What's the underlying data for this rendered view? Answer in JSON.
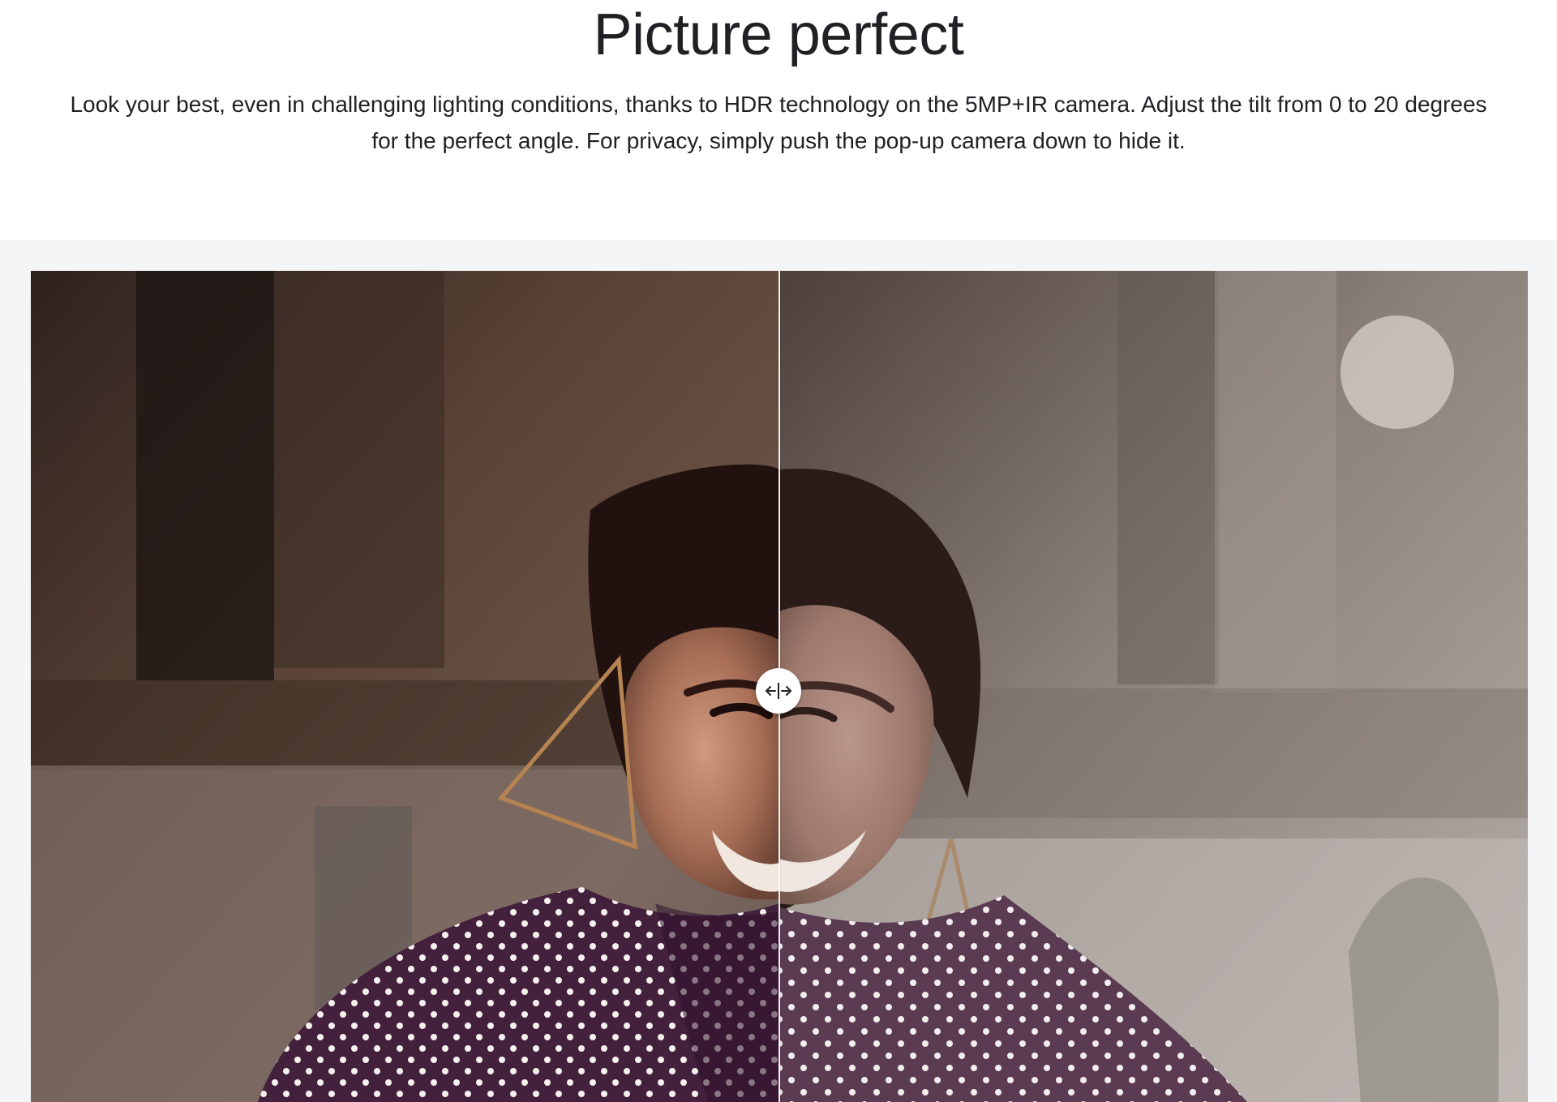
{
  "section": {
    "title": "Picture perfect",
    "description": "Look your best, even in challenging lighting conditions, thanks to HDR technology on the 5MP+IR camera. Adjust the tilt from 0 to 20 degrees for the perfect angle. For privacy, simply push the pop-up camera down to hide it."
  },
  "comparison": {
    "handle_icon": "left-right-arrows-icon",
    "left_image": "hdr-portrait-photo",
    "right_image": "standard-portrait-photo",
    "colors": {
      "left_background": "#4d3a31",
      "right_background": "#8a8078",
      "shirt": "#43213c",
      "divider": "#ffffff"
    }
  }
}
